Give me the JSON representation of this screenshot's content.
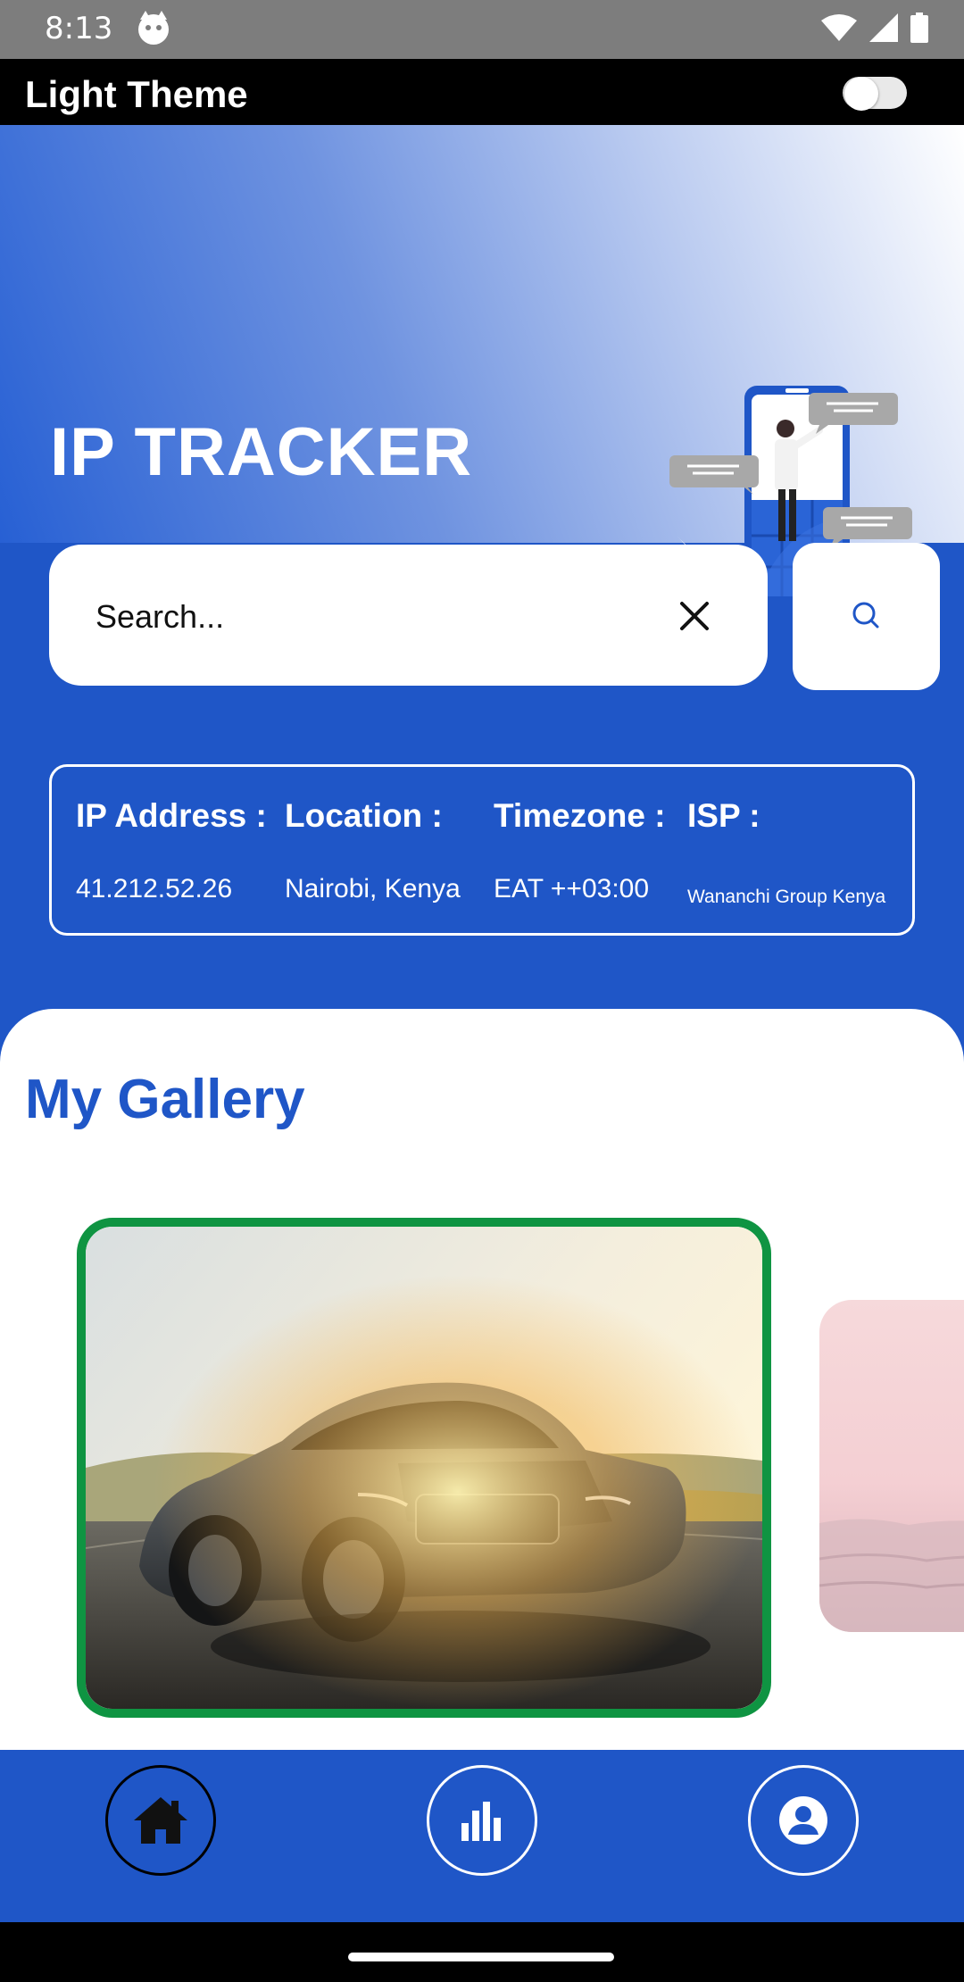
{
  "status_bar": {
    "time": "8:13"
  },
  "theme": {
    "label": "Light Theme",
    "enabled": false
  },
  "hero": {
    "title": "IP TRACKER",
    "gradient": [
      "#2760d4",
      "#ffffff"
    ]
  },
  "search": {
    "value": "Search...",
    "clear_icon": "close-icon",
    "search_icon": "search-icon"
  },
  "info": {
    "ip": {
      "label": "IP Address :",
      "value": "41.212.52.26"
    },
    "location": {
      "label": "Location :",
      "value": "Nairobi, Kenya"
    },
    "timezone": {
      "label": "Timezone :",
      "value": "EAT ++03:00"
    },
    "isp": {
      "label": "ISP :",
      "value": "Wananchi Group Kenya"
    }
  },
  "gallery": {
    "title": "My Gallery",
    "active_border_color": "#0f9442"
  },
  "nav": {
    "items": [
      {
        "icon": "home-icon",
        "active": true
      },
      {
        "icon": "chart-icon",
        "active": false
      },
      {
        "icon": "profile-icon",
        "active": false
      }
    ]
  },
  "colors": {
    "primary": "#1f56c7",
    "accent_green": "#0f9442"
  }
}
